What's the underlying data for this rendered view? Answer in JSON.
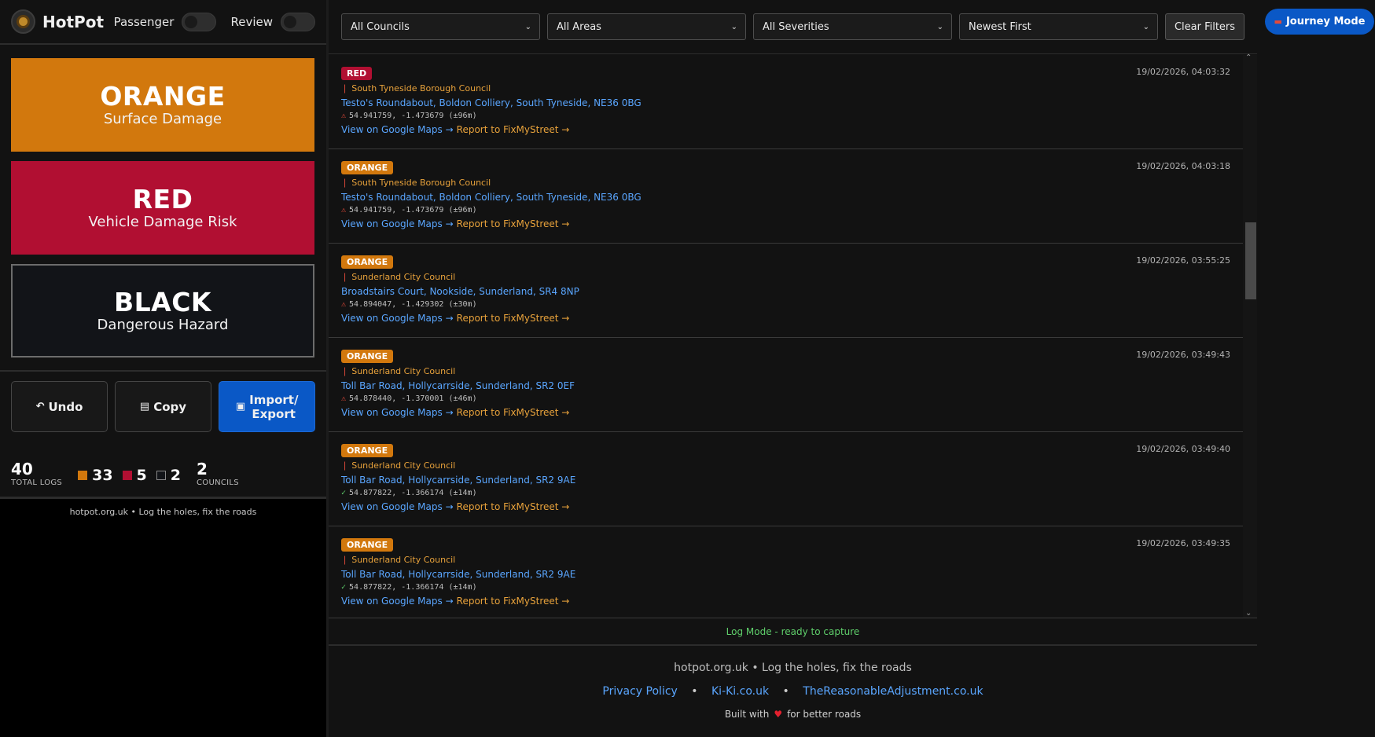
{
  "app": {
    "title": "HotPot"
  },
  "toggles": {
    "passenger_label": "Passenger",
    "review_label": "Review"
  },
  "severity_buttons": [
    {
      "name": "ORANGE",
      "desc": "Surface Damage"
    },
    {
      "name": "RED",
      "desc": "Vehicle Damage Risk"
    },
    {
      "name": "BLACK",
      "desc": "Dangerous Hazard"
    }
  ],
  "actions": {
    "undo_label": "Undo",
    "copy_label": "Copy",
    "import_label": "Import/ Export"
  },
  "stats": {
    "total": "40",
    "total_label": "TOTAL LOGS",
    "orange": "33",
    "red": "5",
    "black": "2",
    "councils": "2",
    "councils_label": "COUNCILS"
  },
  "left_footer": "hotpot.org.uk • Log the holes, fix the roads",
  "filters": {
    "councils": "All Councils",
    "areas": "All Areas",
    "severities": "All Severities",
    "sort": "Newest First",
    "clear_label": "Clear Filters"
  },
  "entries": [
    {
      "severity": "RED",
      "time": "19/02/2026, 04:03:32",
      "council": "South Tyneside Borough Council",
      "address": "Testo's Roundabout, Boldon Colliery, South Tyneside, NE36 0BG",
      "coords": "54.941759, -1.473679 (±96m)",
      "accuracy_ok": false,
      "maps": "View on Google Maps →",
      "fix": "Report to FixMyStreet →"
    },
    {
      "severity": "ORANGE",
      "time": "19/02/2026, 04:03:18",
      "council": "South Tyneside Borough Council",
      "address": "Testo's Roundabout, Boldon Colliery, South Tyneside, NE36 0BG",
      "coords": "54.941759, -1.473679 (±96m)",
      "accuracy_ok": false,
      "maps": "View on Google Maps →",
      "fix": "Report to FixMyStreet →"
    },
    {
      "severity": "ORANGE",
      "time": "19/02/2026, 03:55:25",
      "council": "Sunderland City Council",
      "address": "Broadstairs Court, Nookside, Sunderland, SR4 8NP",
      "coords": "54.894047, -1.429302 (±30m)",
      "accuracy_ok": false,
      "maps": "View on Google Maps →",
      "fix": "Report to FixMyStreet →"
    },
    {
      "severity": "ORANGE",
      "time": "19/02/2026, 03:49:43",
      "council": "Sunderland City Council",
      "address": "Toll Bar Road, Hollycarrside, Sunderland, SR2 0EF",
      "coords": "54.878440, -1.370001 (±46m)",
      "accuracy_ok": false,
      "maps": "View on Google Maps →",
      "fix": "Report to FixMyStreet →"
    },
    {
      "severity": "ORANGE",
      "time": "19/02/2026, 03:49:40",
      "council": "Sunderland City Council",
      "address": "Toll Bar Road, Hollycarrside, Sunderland, SR2 9AE",
      "coords": "54.877822, -1.366174 (±14m)",
      "accuracy_ok": true,
      "maps": "View on Google Maps →",
      "fix": "Report to FixMyStreet →"
    },
    {
      "severity": "ORANGE",
      "time": "19/02/2026, 03:49:35",
      "council": "Sunderland City Council",
      "address": "Toll Bar Road, Hollycarrside, Sunderland, SR2 9AE",
      "coords": "54.877822, -1.366174 (±14m)",
      "accuracy_ok": true,
      "maps": "View on Google Maps →",
      "fix": "Report to FixMyStreet →"
    }
  ],
  "status": "Log Mode - ready to capture",
  "footer": {
    "line1": "hotpot.org.uk • Log the holes, fix the roads",
    "links": [
      "Privacy Policy",
      "Ki-Ki.co.uk",
      "TheReasonableAdjustment.co.uk"
    ],
    "built_prefix": "Built with",
    "built_suffix": "for better roads"
  },
  "journey": {
    "label": "Journey Mode"
  },
  "colors": {
    "orange": "#d2780d",
    "red": "#b10f32",
    "black": "#121418",
    "link": "#5aa6ff",
    "accent": "#0a58c6"
  }
}
